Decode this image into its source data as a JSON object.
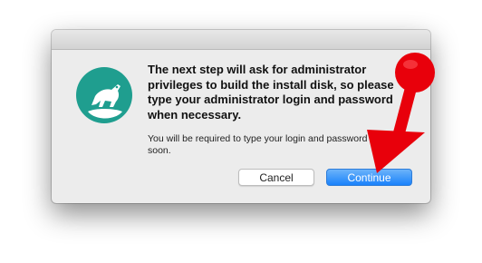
{
  "dialog": {
    "message_lines": [
      "The next step will ask for administrator",
      "privileges to build the install disk, so please",
      "type your administrator login and password",
      "when necessary."
    ],
    "info_lines": [
      "You will be required to type your login and password",
      "soon."
    ],
    "cancel_label": "Cancel",
    "continue_label": "Continue",
    "icon": "disk-maker-cougar-icon"
  },
  "annotation": {
    "type": "red-arrow-pointer",
    "color": "#e8000b"
  },
  "colors": {
    "dialog_bg": "#ececec",
    "accent_blue": "#1a82fb",
    "icon_teal": "#1f9e8f"
  }
}
